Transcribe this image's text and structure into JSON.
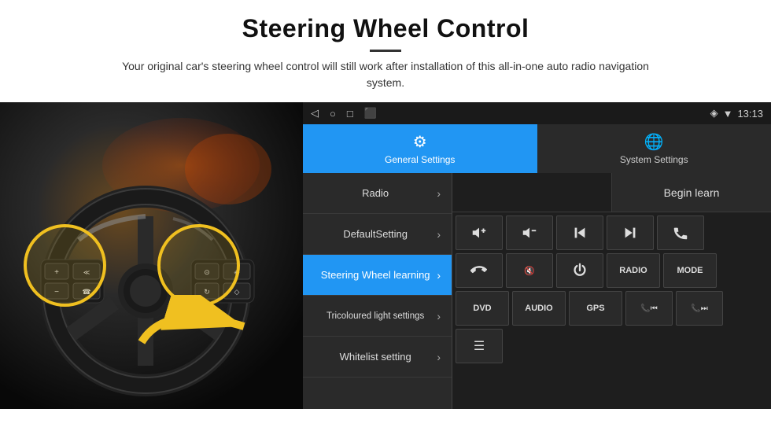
{
  "header": {
    "title": "Steering Wheel Control",
    "subtitle": "Your original car's steering wheel control will still work after installation of this all-in-one auto radio navigation system."
  },
  "statusBar": {
    "time": "13:13",
    "icons": [
      "◁",
      "○",
      "□",
      "⬛"
    ]
  },
  "tabs": [
    {
      "id": "general",
      "label": "General Settings",
      "active": true
    },
    {
      "id": "system",
      "label": "System Settings",
      "active": false
    }
  ],
  "menu": [
    {
      "id": "radio",
      "label": "Radio",
      "active": false
    },
    {
      "id": "default",
      "label": "DefaultSetting",
      "active": false
    },
    {
      "id": "steering",
      "label": "Steering Wheel learning",
      "active": true
    },
    {
      "id": "tricoloured",
      "label": "Tricoloured light settings",
      "active": false
    },
    {
      "id": "whitelist",
      "label": "Whitelist setting",
      "active": false
    }
  ],
  "beginLearn": "Begin learn",
  "controlButtons": {
    "row1": [
      {
        "id": "vol-up",
        "symbol": "🔊+"
      },
      {
        "id": "vol-down",
        "symbol": "🔈−"
      },
      {
        "id": "prev",
        "symbol": "⏮"
      },
      {
        "id": "next",
        "symbol": "⏭"
      },
      {
        "id": "phone",
        "symbol": "📞"
      }
    ],
    "row2": [
      {
        "id": "hang-up",
        "symbol": "📵"
      },
      {
        "id": "mute",
        "symbol": "🔇"
      },
      {
        "id": "power",
        "symbol": "⏻"
      },
      {
        "id": "radio-btn",
        "symbol": "RADIO"
      },
      {
        "id": "mode",
        "symbol": "MODE"
      }
    ],
    "row3": [
      {
        "id": "dvd",
        "symbol": "DVD"
      },
      {
        "id": "audio",
        "symbol": "AUDIO"
      },
      {
        "id": "gps",
        "symbol": "GPS"
      },
      {
        "id": "phone-prev",
        "symbol": "📞⏮"
      },
      {
        "id": "phone-next",
        "symbol": "📞⏭"
      }
    ],
    "row4": [
      {
        "id": "list",
        "symbol": "☰"
      }
    ]
  }
}
